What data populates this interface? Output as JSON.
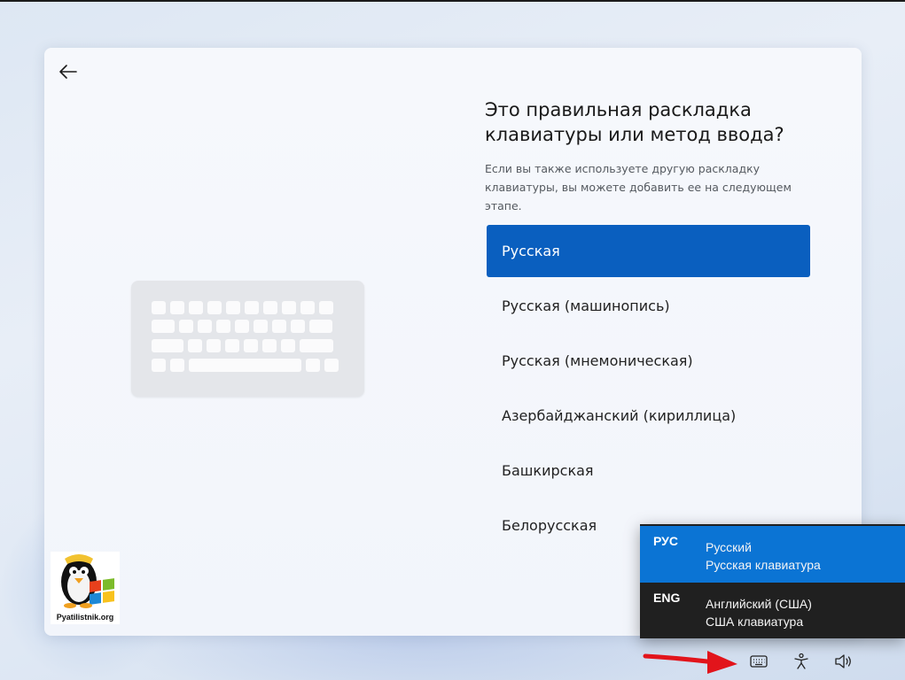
{
  "page": {
    "title": "Это правильная раскладка клавиатуры или метод ввода?",
    "subtitle": "Если вы также используете другую раскладку клавиатуры, вы можете добавить ее на следующем этапе."
  },
  "layouts": [
    {
      "label": "Русская",
      "selected": true
    },
    {
      "label": "Русская (машинопись)",
      "selected": false
    },
    {
      "label": "Русская (мнемоническая)",
      "selected": false
    },
    {
      "label": "Азербайджанский (кириллица)",
      "selected": false
    },
    {
      "label": "Башкирская",
      "selected": false
    },
    {
      "label": "Белорусская",
      "selected": false
    }
  ],
  "language_popup": {
    "items": [
      {
        "code": "РУС",
        "name": "Русский",
        "keyboard": "Русская клавиатура",
        "active": true
      },
      {
        "code": "ENG",
        "name": "Английский (США)",
        "keyboard": "США клавиатура",
        "active": false
      }
    ]
  },
  "tray": {
    "icons": [
      "keyboard-icon",
      "accessibility-icon",
      "volume-icon"
    ]
  },
  "logo": {
    "text": "Pyatilistnik.org"
  },
  "colors": {
    "accent": "#0a5fbf",
    "popup_active": "#0b74d4",
    "popup_bg": "#202020",
    "annotation_arrow": "#e2141b"
  }
}
